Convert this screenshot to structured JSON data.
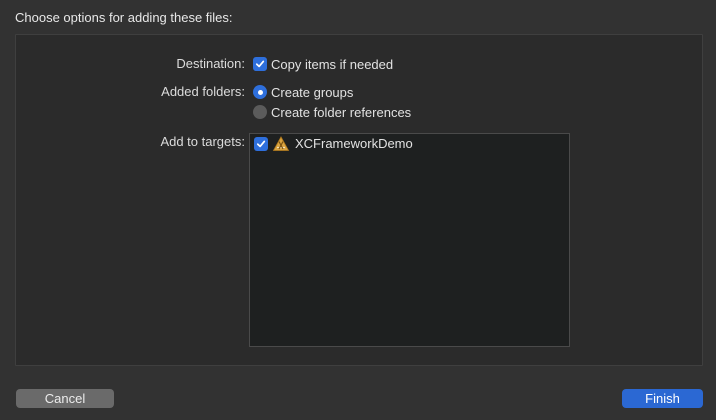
{
  "dialog": {
    "title": "Choose options for adding these files:"
  },
  "destination": {
    "label": "Destination:",
    "copy_items_label": "Copy items if needed",
    "copy_items_checked": true
  },
  "added_folders": {
    "label": "Added folders:",
    "options": [
      {
        "label": "Create groups",
        "selected": true
      },
      {
        "label": "Create folder references",
        "selected": false
      }
    ]
  },
  "targets": {
    "label": "Add to targets:",
    "items": [
      {
        "name": "XCFrameworkDemo",
        "checked": true,
        "icon": "app-target-icon"
      }
    ]
  },
  "buttons": {
    "cancel_label": "Cancel",
    "finish_label": "Finish"
  },
  "colors": {
    "accent": "#2e6fdc",
    "background": "#323232",
    "panel": "#2b2b2b"
  }
}
